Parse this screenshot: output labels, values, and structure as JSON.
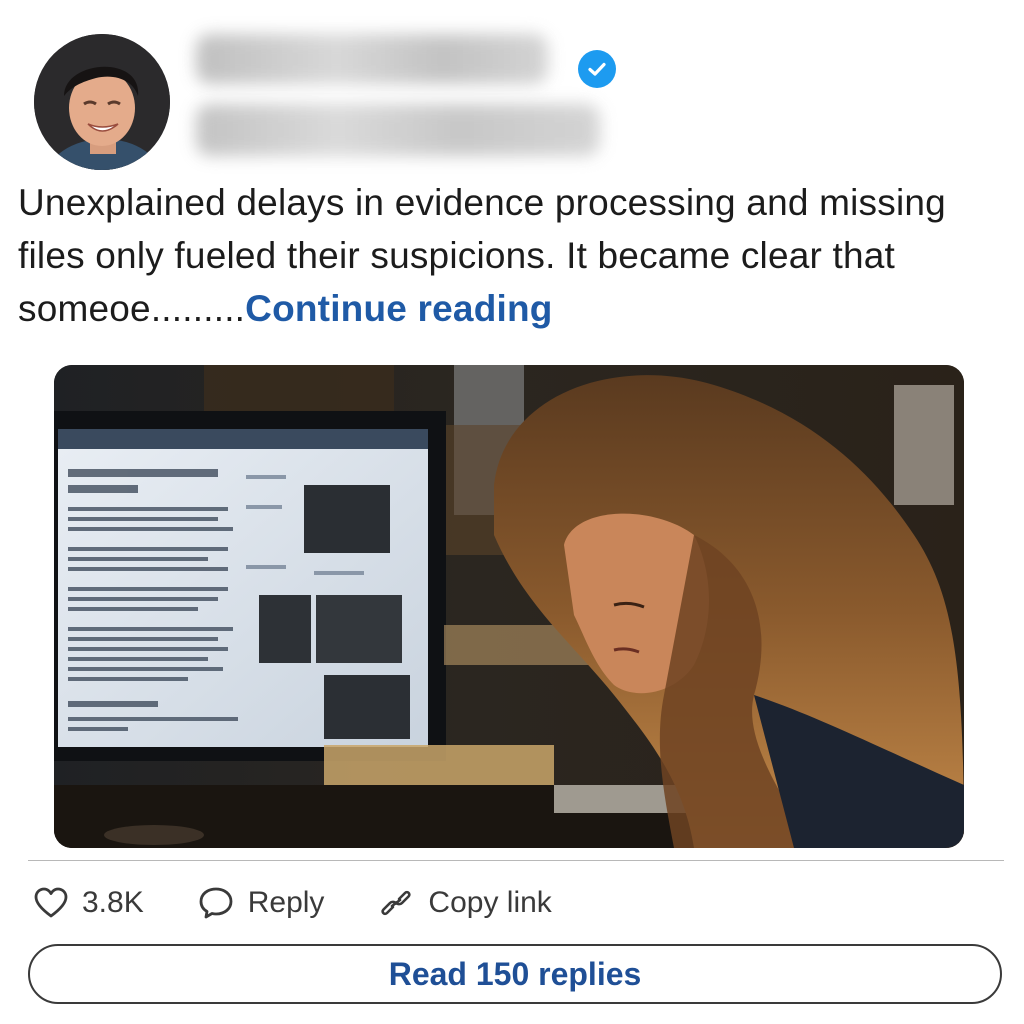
{
  "author": {
    "verified_badge_color": "#1d9bf0"
  },
  "post": {
    "text": "Unexplained delays in evidence processing and missing files only fueled their suspicions. It became clear that someoe.........",
    "continue_label": "Continue reading"
  },
  "media": {
    "icon": "photo-image"
  },
  "actions": {
    "like_count": "3.8K",
    "reply_label": "Reply",
    "copy_link_label": "Copy link",
    "icons": [
      "heart-icon",
      "reply-bubble-icon",
      "link-icon"
    ]
  },
  "read_replies": {
    "label": "Read 150 replies"
  },
  "colors": {
    "link": "#1f5aa6",
    "read_button_text": "#1f4f96"
  }
}
